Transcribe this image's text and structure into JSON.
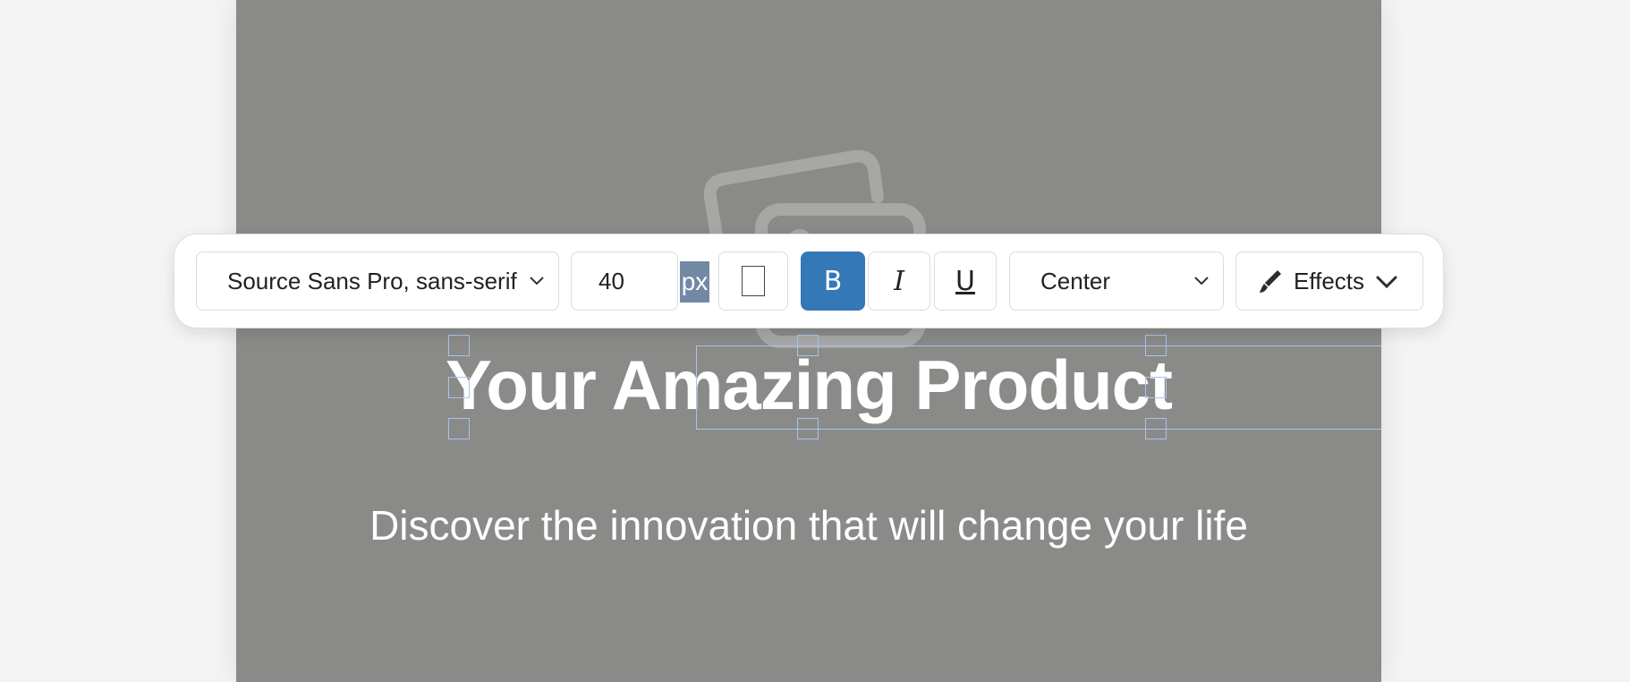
{
  "canvas": {
    "headline": "Your Amazing Product",
    "subline": "Discover the innovation that will change your life"
  },
  "toolbar": {
    "font_family": "Source Sans Pro, sans-serif",
    "font_size": "40",
    "unit": "px",
    "bold_label": "B",
    "italic_label": "I",
    "underline_label": "U",
    "alignment": "Center",
    "effects_label": "Effects"
  },
  "icons": {
    "image_placeholder": "image-icon",
    "font_dropdown": "chevron-down-icon",
    "align_dropdown": "chevron-down-icon",
    "effects": "brush-icon",
    "effects_dropdown": "chevron-down-icon"
  },
  "colors": {
    "canvas_bg": "#8a8a88",
    "bold_active": "#3478b8",
    "unit_highlight": "#7289a5",
    "selection": "#a9c4ee"
  }
}
